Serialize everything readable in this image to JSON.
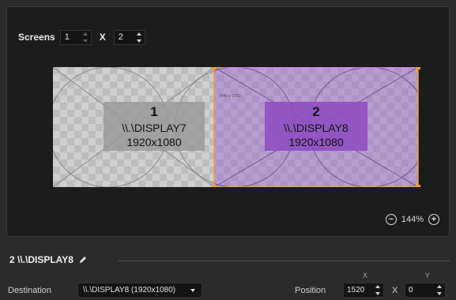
{
  "screens": {
    "label": "Screens",
    "rows": "1",
    "separator": "X",
    "cols": "2"
  },
  "displays": [
    {
      "index": "1",
      "name": "\\\\.\\DISPLAY7",
      "resolution": "1920x1080"
    },
    {
      "index": "2",
      "name": "\\\\.\\DISPLAY8",
      "resolution": "1920x1080",
      "tiny_label": "2440 x 1080"
    }
  ],
  "zoom": {
    "level": "144%",
    "minus": "−",
    "plus": "+"
  },
  "selected": {
    "title": "2 \\\\.\\DISPLAY8"
  },
  "destination": {
    "label": "Destination",
    "value": "\\\\.\\DISPLAY8 (1920x1080)"
  },
  "position": {
    "label": "Position",
    "x_label": "X",
    "y_label": "Y",
    "x": "1520",
    "separator": "X",
    "y": "0"
  },
  "colors": {
    "accent": "#f0a020",
    "selected_fill": "#8f4fc0"
  }
}
